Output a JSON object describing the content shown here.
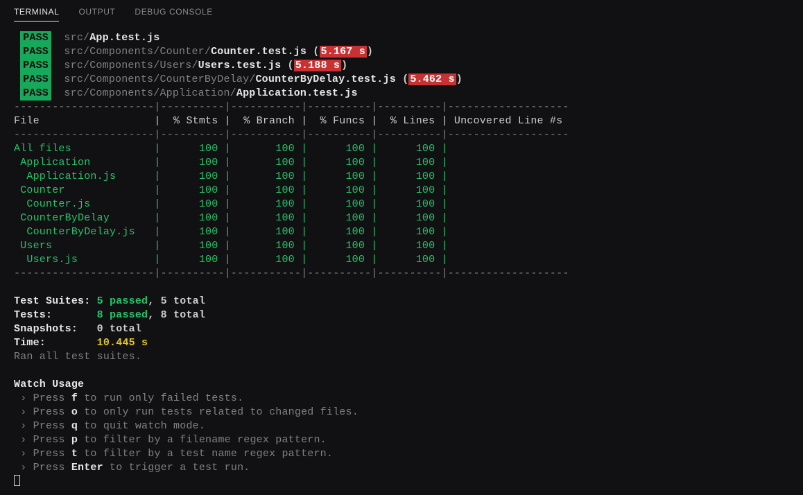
{
  "tabs": {
    "terminal": "TERMINAL",
    "output": "OUTPUT",
    "debug": "DEBUG CONSOLE"
  },
  "badge_pass": "PASS",
  "runs": [
    {
      "path": "src/",
      "file": "App.test.js",
      "time": null
    },
    {
      "path": "src/Components/Counter/",
      "file": "Counter.test.js",
      "time": "5.167 s"
    },
    {
      "path": "src/Components/Users/",
      "file": "Users.test.js",
      "time": "5.188 s"
    },
    {
      "path": "src/Components/CounterByDelay/",
      "file": "CounterByDelay.test.js",
      "time": "5.462 s"
    },
    {
      "path": "src/Components/Application/",
      "file": "Application.test.js",
      "time": null
    }
  ],
  "cov": {
    "columns": [
      "File",
      "% Stmts",
      "% Branch",
      "% Funcs",
      "% Lines",
      "Uncovered Line #s"
    ],
    "rows": [
      {
        "indent": 0,
        "name": "All files",
        "stmts": "100",
        "branch": "100",
        "funcs": "100",
        "lines": "100"
      },
      {
        "indent": 1,
        "name": "Application",
        "stmts": "100",
        "branch": "100",
        "funcs": "100",
        "lines": "100"
      },
      {
        "indent": 2,
        "name": "Application.js",
        "stmts": "100",
        "branch": "100",
        "funcs": "100",
        "lines": "100"
      },
      {
        "indent": 1,
        "name": "Counter",
        "stmts": "100",
        "branch": "100",
        "funcs": "100",
        "lines": "100"
      },
      {
        "indent": 2,
        "name": "Counter.js",
        "stmts": "100",
        "branch": "100",
        "funcs": "100",
        "lines": "100"
      },
      {
        "indent": 1,
        "name": "CounterByDelay",
        "stmts": "100",
        "branch": "100",
        "funcs": "100",
        "lines": "100"
      },
      {
        "indent": 2,
        "name": "CounterByDelay.js",
        "stmts": "100",
        "branch": "100",
        "funcs": "100",
        "lines": "100"
      },
      {
        "indent": 1,
        "name": "Users",
        "stmts": "100",
        "branch": "100",
        "funcs": "100",
        "lines": "100"
      },
      {
        "indent": 2,
        "name": "Users.js",
        "stmts": "100",
        "branch": "100",
        "funcs": "100",
        "lines": "100"
      }
    ]
  },
  "summary": {
    "suites_label": "Test Suites:",
    "suites_pass": "5 passed",
    "suites_rest": ", 5 total",
    "tests_label": "Tests:",
    "tests_pass": "8 passed",
    "tests_rest": ", 8 total",
    "snap_label": "Snapshots:",
    "snap_val": "0 total",
    "time_label": "Time:",
    "time_val": "10.445 s",
    "ran": "Ran all test suites."
  },
  "watch": {
    "heading": "Watch Usage",
    "chev": " › ",
    "press": "Press ",
    "lines": [
      {
        "key": "f",
        "text": " to run only failed tests."
      },
      {
        "key": "o",
        "text": " to only run tests related to changed files."
      },
      {
        "key": "q",
        "text": " to quit watch mode."
      },
      {
        "key": "p",
        "text": " to filter by a filename regex pattern."
      },
      {
        "key": "t",
        "text": " to filter by a test name regex pattern."
      },
      {
        "key": "Enter",
        "text": " to trigger a test run."
      }
    ]
  }
}
